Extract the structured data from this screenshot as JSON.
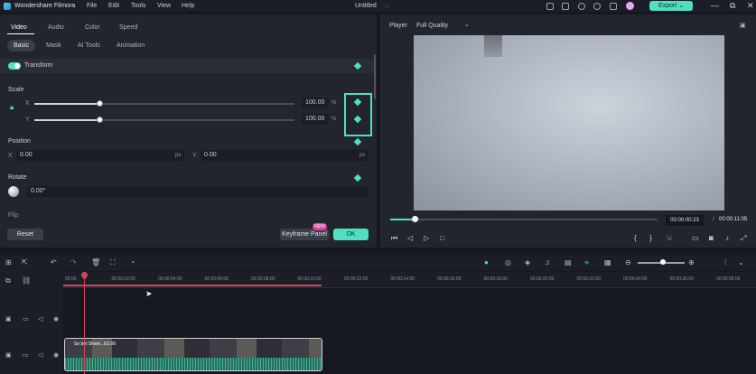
{
  "titlebar": {
    "app_name": "Wondershare Filmora",
    "menus": [
      "File",
      "Edit",
      "Tools",
      "View",
      "Help"
    ],
    "project_title": "Untitled",
    "export_label": "Export",
    "export_chevron": "⌄"
  },
  "editor": {
    "tabs": [
      "Video",
      "Audio",
      "Color",
      "Speed"
    ],
    "subtabs": [
      "Basic",
      "Mask",
      "AI Tools",
      "Animation"
    ],
    "transform_label": "Transform",
    "scale": {
      "label": "Scale",
      "x_label": "X",
      "y_label": "Y",
      "x_value": "100.00",
      "y_value": "100.00",
      "unit": "%",
      "x_level": 0.25,
      "y_level": 0.25
    },
    "position": {
      "label": "Position",
      "x_label": "X",
      "y_label": "Y",
      "x_value": "0.00",
      "y_value": "0.00",
      "unit": "px"
    },
    "rotate": {
      "label": "Rotate",
      "value": "0.00°"
    },
    "flip_label": "Flip",
    "reset_label": "Reset",
    "keyframe_panel_label": "Keyframe Panel",
    "new_badge": "NEW",
    "ok_label": "OK"
  },
  "player": {
    "label": "Player",
    "quality": "Full Quality",
    "current_time": "00:00:00:23",
    "separator": "/",
    "total_time": "00:00:11:05",
    "progress": 0.09
  },
  "timeline": {
    "ruler_labels": [
      "00:00",
      "00:00:02:00",
      "00:00:04:00",
      "00:00:06:00",
      "00:00:08:00",
      "00:00:10:00",
      "00:00:12:00",
      "00:00:14:00",
      "00:00:16:00",
      "00:00:18:00",
      "00:00:20:00",
      "00:00:22:00",
      "00:00:24:00",
      "00:00:26:00",
      "00:00:28:00"
    ],
    "clip_label": "Sn bet Sheet...E3.00"
  },
  "colors": {
    "accent": "#4fe0c2",
    "playhead": "#d4455a",
    "panel_bg": "#22252d",
    "app_bg": "#151820"
  }
}
